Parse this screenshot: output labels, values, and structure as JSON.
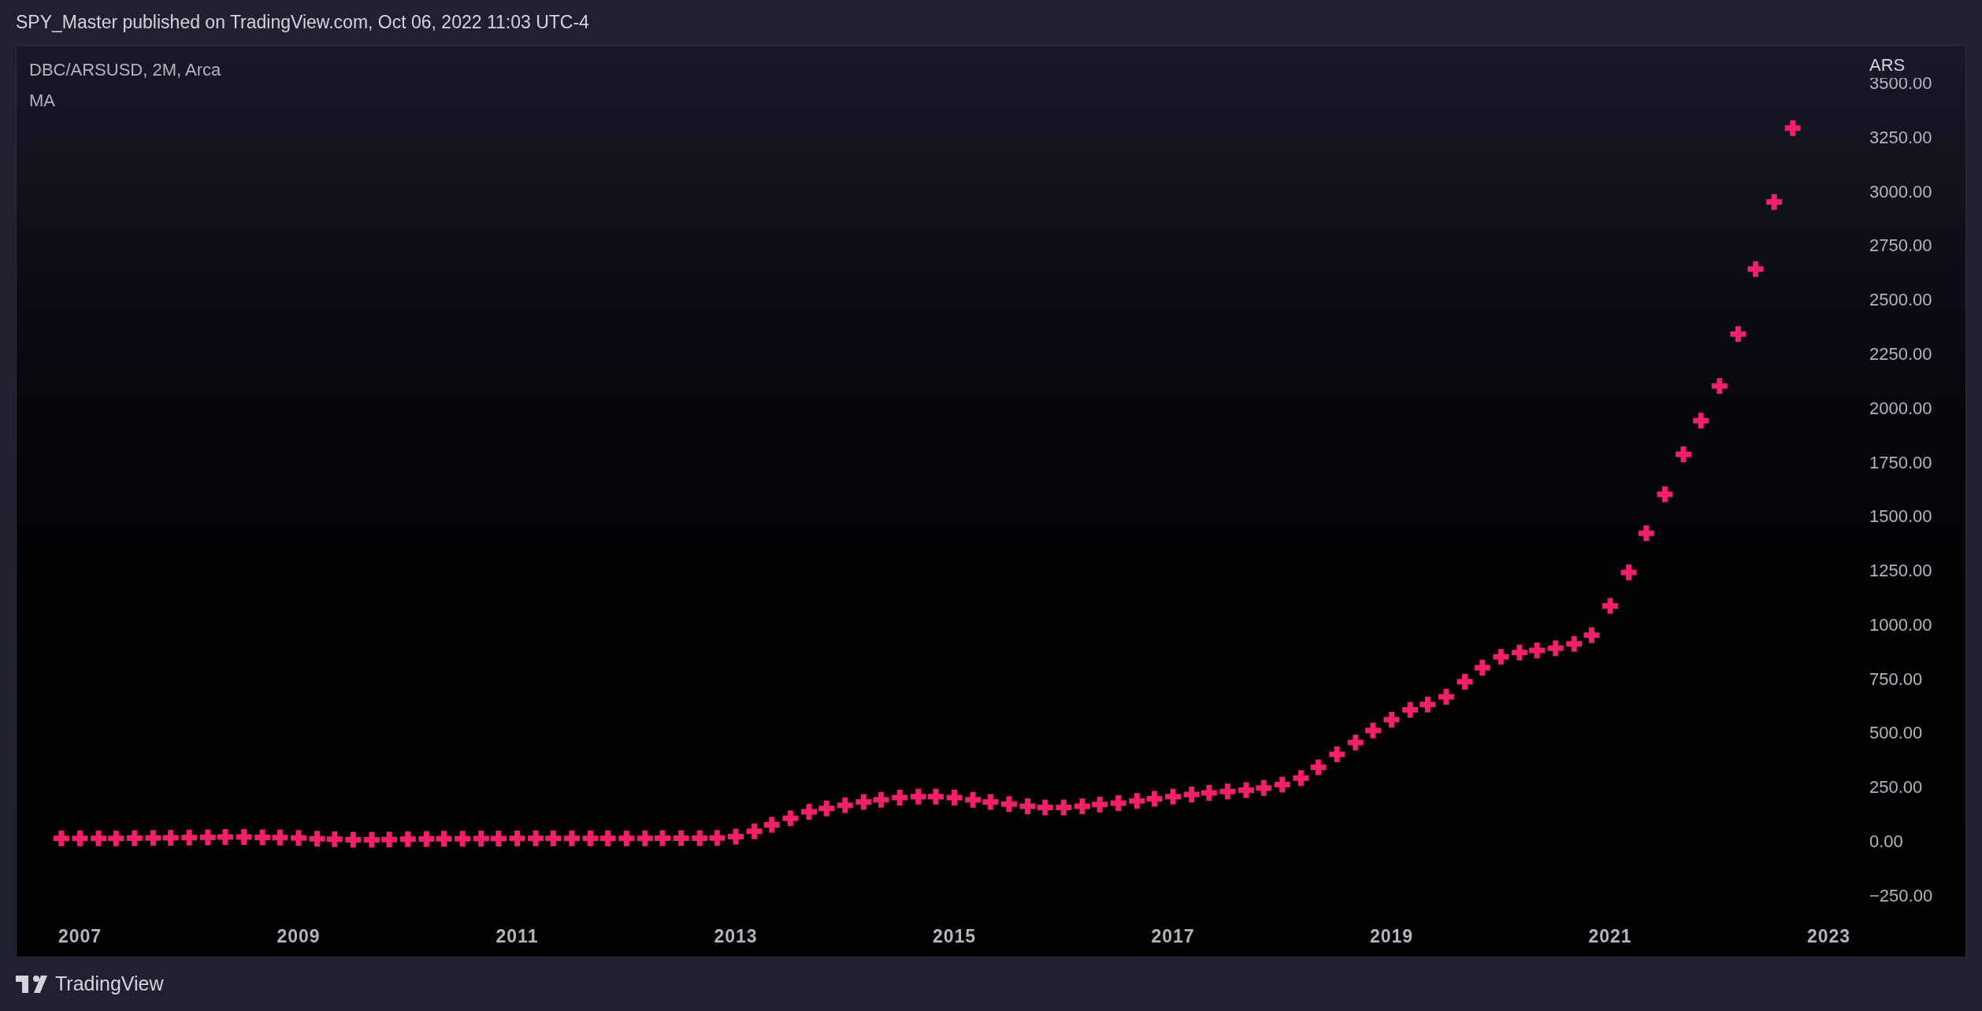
{
  "header": {
    "text": "SPY_Master published on TradingView.com, Oct 06, 2022 11:03 UTC-4"
  },
  "legend": {
    "symbol": "DBC/ARSUSD, 2M, Arca"
  },
  "chart": {
    "chart_data": {
      "type": "scatter",
      "ylabel": "ARS",
      "xlim": [
        2006.42,
        2024.25
      ],
      "ylim": [
        -534,
        3671
      ],
      "xticks": [
        2007,
        2009,
        2011,
        2013,
        2015,
        2017,
        2019,
        2021,
        2023
      ],
      "yticks": [
        {
          "value": -250,
          "label": "−250.00"
        },
        {
          "value": 0,
          "label": "0.00"
        },
        {
          "value": 250,
          "label": "250.00"
        },
        {
          "value": 500,
          "label": "500.00"
        },
        {
          "value": 750,
          "label": "750.00"
        },
        {
          "value": 1000,
          "label": "1000.00"
        },
        {
          "value": 1250,
          "label": "1250.00"
        },
        {
          "value": 1500,
          "label": "1500.00"
        },
        {
          "value": 1750,
          "label": "1750.00"
        },
        {
          "value": 2000,
          "label": "2000.00"
        },
        {
          "value": 2250,
          "label": "2250.00"
        },
        {
          "value": 2500,
          "label": "2500.00"
        },
        {
          "value": 2750,
          "label": "2750.00"
        },
        {
          "value": 3000,
          "label": "3000.00"
        },
        {
          "value": 3250,
          "label": "3250.00"
        },
        {
          "value": 3500,
          "label": "3500.00"
        }
      ],
      "x": [
        2006.83,
        2007,
        2007.17,
        2007.33,
        2007.5,
        2007.67,
        2007.83,
        2008,
        2008.17,
        2008.33,
        2008.5,
        2008.67,
        2008.83,
        2009,
        2009.17,
        2009.33,
        2009.5,
        2009.67,
        2009.83,
        2010,
        2010.17,
        2010.33,
        2010.5,
        2010.67,
        2010.83,
        2011,
        2011.17,
        2011.33,
        2011.5,
        2011.67,
        2011.83,
        2012,
        2012.17,
        2012.33,
        2012.5,
        2012.67,
        2012.83,
        2013,
        2013.17,
        2013.33,
        2013.5,
        2013.67,
        2013.83,
        2014,
        2014.17,
        2014.33,
        2014.5,
        2014.67,
        2014.83,
        2015,
        2015.17,
        2015.33,
        2015.5,
        2015.67,
        2015.83,
        2016,
        2016.17,
        2016.33,
        2016.5,
        2016.67,
        2016.83,
        2017,
        2017.17,
        2017.33,
        2017.5,
        2017.67,
        2017.83,
        2018,
        2018.17,
        2018.33,
        2018.5,
        2018.67,
        2018.83,
        2019,
        2019.17,
        2019.33,
        2019.5,
        2019.67,
        2019.83,
        2020,
        2020.17,
        2020.33,
        2020.5,
        2020.67,
        2020.83,
        2021,
        2021.17,
        2021.33,
        2021.5,
        2021.67,
        2021.83,
        2022,
        2022.17,
        2022.33,
        2022.5,
        2022.67
      ],
      "series": [
        {
          "name": "MA",
          "color": "#f0206a",
          "values": [
            12,
            12,
            12,
            12,
            13,
            14,
            15,
            16,
            17,
            18,
            18,
            17,
            16,
            14,
            10,
            8,
            6,
            6,
            7,
            8,
            9,
            10,
            10,
            11,
            11,
            12,
            12,
            12,
            12,
            12,
            12,
            12,
            12,
            13,
            13,
            13,
            14,
            20,
            45,
            75,
            105,
            135,
            150,
            165,
            180,
            190,
            200,
            205,
            205,
            200,
            190,
            180,
            170,
            160,
            155,
            155,
            160,
            168,
            175,
            185,
            195,
            205,
            215,
            222,
            228,
            235,
            245,
            260,
            290,
            340,
            400,
            455,
            510,
            560,
            605,
            630,
            665,
            735,
            800,
            850,
            870,
            880,
            890,
            910,
            950,
            1085,
            1240,
            1420,
            1600,
            1785,
            1940,
            2100,
            2340,
            2640,
            2950,
            3290
          ]
        }
      ]
    }
  },
  "footer": {
    "brand": "TradingView"
  }
}
